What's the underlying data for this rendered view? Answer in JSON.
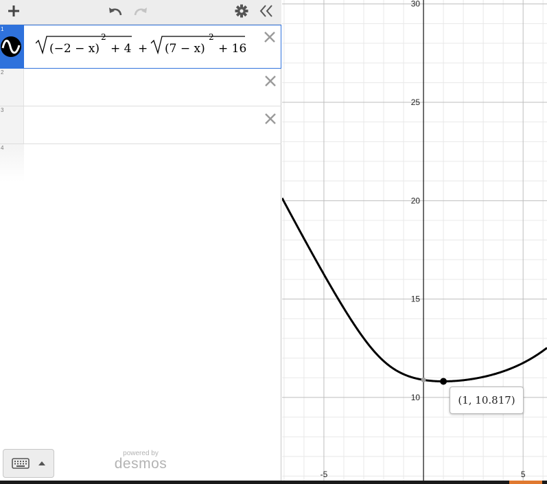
{
  "panel": {
    "toolbar": {
      "add_icon": "plus-icon",
      "undo_icon": "undo-icon",
      "redo_icon": "redo-icon",
      "settings_icon": "gear-icon",
      "collapse_icon": "double-chevron-left-icon"
    },
    "expressions": [
      {
        "number": "1",
        "active": true,
        "icon": "sine-wave-icon",
        "latex": "\\sqrt{(-2-x)^2+4}+\\sqrt{(7-x)^2+16}",
        "term1_inner": "(−2 − x)",
        "term1_plus": "+ 4",
        "term2_inner": "(7 − x)",
        "term2_plus": "+ 16",
        "exponent": "2",
        "join": "+"
      },
      {
        "number": "2",
        "latex": ""
      },
      {
        "number": "3",
        "latex": ""
      },
      {
        "number": "4",
        "latex": ""
      }
    ],
    "keyboard_icon": "keyboard-icon",
    "keyboard_arrow_icon": "caret-up-icon",
    "branding": {
      "powered_by": "powered by",
      "brand": "desmos"
    }
  },
  "graph": {
    "x_ticks": [
      "-5",
      "5"
    ],
    "y_ticks": [
      "10",
      "15",
      "20",
      "25",
      "30"
    ],
    "curve_color": "#000000",
    "axis_color": "#222222",
    "major_grid_color": "#bdbdbd",
    "minor_grid_color": "#e8e8e8"
  },
  "chart_data": {
    "type": "line",
    "function": "sqrt((-2-x)^2+4)+sqrt((7-x)^2+16)",
    "xlim": [
      -7.1,
      6.2
    ],
    "ylim": [
      5.6,
      30.2
    ],
    "x_major_step": 5,
    "y_major_step": 5,
    "grid": true,
    "points": [
      {
        "x": 0,
        "y": 10.89,
        "style": "gray"
      },
      {
        "x": 1,
        "y": 10.817,
        "style": "black"
      }
    ],
    "tooltip": "(1, 10.817)"
  }
}
